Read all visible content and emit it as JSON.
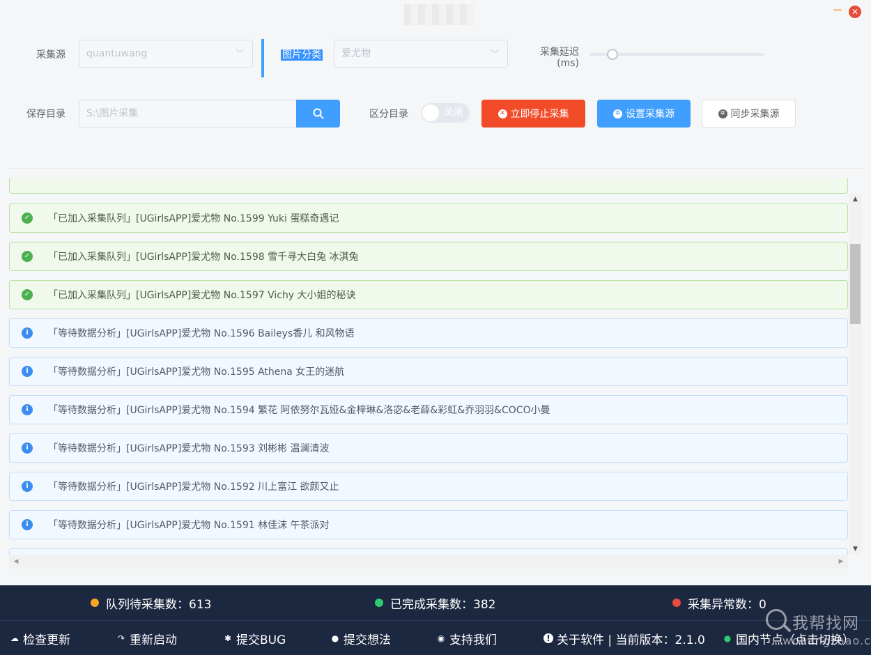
{
  "window": {
    "minimize_glyph": "−",
    "close_glyph": "✕"
  },
  "form": {
    "source_label": "采集源",
    "source_value": "quantuwang",
    "category_label": "图片分类",
    "category_value": "爱尤物",
    "delay_label_line1": "采集延迟",
    "delay_label_line2": "(ms)",
    "save_dir_label": "保存目录",
    "save_dir_placeholder": "S:\\图片采集",
    "separate_dir_label": "区分目录",
    "toggle_text": "关闭",
    "stop_button": "立即停止采集",
    "settings_button": "设置采集源",
    "sync_button": "同步采集源"
  },
  "log": [
    {
      "type": "success",
      "text": "「已加入采集队列」[UGirlsAPP]爱尤物 No.1599 Yuki 蛋糕奇遇记"
    },
    {
      "type": "success",
      "text": "「已加入采集队列」[UGirlsAPP]爱尤物 No.1598 雪千寻大白兔 冰淇兔"
    },
    {
      "type": "success",
      "text": "「已加入采集队列」[UGirlsAPP]爱尤物 No.1597 Vichy 大小姐的秘诀"
    },
    {
      "type": "info",
      "text": "「等待数据分析」[UGirlsAPP]爱尤物 No.1596 Baileys香儿 和风物语"
    },
    {
      "type": "info",
      "text": "「等待数据分析」[UGirlsAPP]爱尤物 No.1595 Athena 女王的迷航"
    },
    {
      "type": "info",
      "text": "「等待数据分析」[UGirlsAPP]爱尤物 No.1594 繁花 阿依努尔瓦娅&金梓琳&洛宓&老薛&彩虹&乔羽羽&COCO小曼"
    },
    {
      "type": "info",
      "text": "「等待数据分析」[UGirlsAPP]爱尤物 No.1593 刘彬彬 温澜清波"
    },
    {
      "type": "info",
      "text": "「等待数据分析」[UGirlsAPP]爱尤物 No.1592 川上富江 欲颜又止"
    },
    {
      "type": "info",
      "text": "「等待数据分析」[UGirlsAPP]爱尤物 No.1591 林佳沫 午茶派对"
    }
  ],
  "stats": {
    "queue": "队列待采集数：613",
    "done": "已完成采集数：382",
    "errors": "采集异常数：0",
    "colors": {
      "queue": "#f5a623",
      "done": "#2ecc71",
      "errors": "#e74c3c"
    }
  },
  "footer": {
    "check_update": "检查更新",
    "restart": "重新启动",
    "submit_bug": "提交BUG",
    "submit_idea": "提交想法",
    "support": "支持我们",
    "about": "关于软件 | 当前版本：2.1.0",
    "node": "国内节点（点击切换）"
  },
  "watermark": {
    "line1": "我帮找网",
    "line2": "wobangzhao.com"
  }
}
